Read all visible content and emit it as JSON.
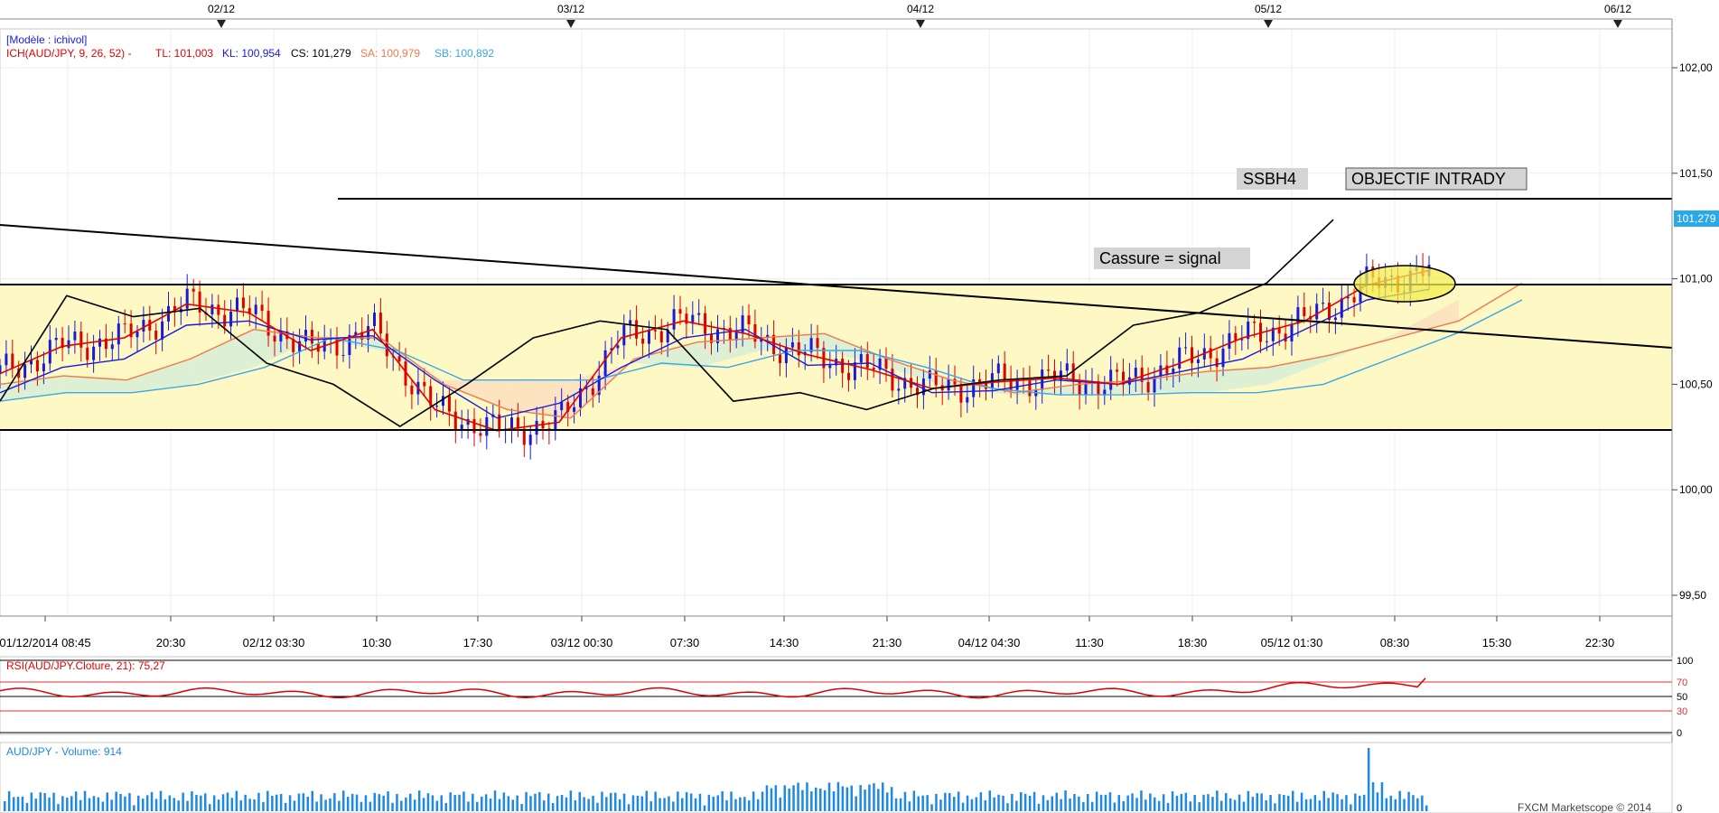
{
  "header": {
    "model_label": "[Modèle : ichivol]",
    "ich_label": "ICH(AUD/JPY, 9, 26, 52) -",
    "tl_label": "TL: 101,003",
    "kl_label": "KL: 100,954",
    "cs_label": "CS: 101,279",
    "sa_label": "SA: 100,979",
    "sb_label": "SB: 100,892"
  },
  "top_dates": [
    "02/12",
    "03/12",
    "04/12",
    "05/12",
    "06/12"
  ],
  "time_axis": [
    "01/12/2014 08:45",
    "20:30",
    "02/12 03:30",
    "10:30",
    "17:30",
    "03/12 00:30",
    "07:30",
    "14:30",
    "21:30",
    "04/12 04:30",
    "11:30",
    "18:30",
    "05/12 01:30",
    "08:30",
    "15:30",
    "22:30"
  ],
  "price_axis": [
    "102,00",
    "101,50",
    "101,00",
    "100,50",
    "100,00",
    "99,50"
  ],
  "last_price": "101,279",
  "annotations": {
    "ssbh4": "SSBH4",
    "objectif": "OBJECTIF INTRADY",
    "cassure": "Cassure = signal"
  },
  "rsi": {
    "label": "RSI(AUD/JPY.Cloture, 21): 75,27",
    "levels": [
      "100",
      "70",
      "50",
      "30",
      "0"
    ]
  },
  "volume": {
    "label": "AUD/JPY - Volume: 914",
    "axis_label": "0"
  },
  "footer": "FXCM Marketscope © 2014",
  "colors": {
    "tenkan": "#e00000",
    "kijun": "#1a1adc",
    "chikou": "#000000",
    "senkou_a": "#f07848",
    "senkou_b": "#38a8e8",
    "range_fill": "#fdf8c4",
    "kumo_bull": "#d7eed7",
    "kumo_bear": "#fbe0c0",
    "volume": "#1e88e5",
    "ellipse": "#f3ee4a"
  },
  "chart_data": {
    "type": "line",
    "title": "AUD/JPY",
    "ylim": [
      99.4,
      102.2
    ],
    "levels": {
      "resistance_objective": 101.36,
      "range_high": 100.96,
      "range_low": 100.27
    },
    "series": [
      {
        "name": "TL",
        "values": [
          100.55,
          100.68,
          100.72,
          100.88,
          100.84,
          100.66,
          100.76,
          100.38,
          100.28,
          100.32,
          100.72,
          100.8,
          100.74,
          100.64,
          100.57,
          100.48,
          100.51,
          100.53,
          100.5,
          100.6,
          100.72,
          100.8,
          100.97,
          101.04
        ]
      },
      {
        "name": "KL",
        "values": [
          100.46,
          100.58,
          100.62,
          100.78,
          100.8,
          100.71,
          100.73,
          100.52,
          100.34,
          100.41,
          100.58,
          100.72,
          100.76,
          100.59,
          100.6,
          100.46,
          100.47,
          100.52,
          100.5,
          100.56,
          100.62,
          100.76,
          100.9,
          100.95
        ]
      },
      {
        "name": "CS",
        "values": [
          100.42,
          100.92,
          100.82,
          100.86,
          100.6,
          100.5,
          100.3,
          100.5,
          100.72,
          100.8,
          100.76,
          100.42,
          100.46,
          100.38,
          100.48,
          100.52,
          100.54,
          100.78,
          100.84,
          100.98,
          101.28
        ]
      },
      {
        "name": "SA",
        "values": [
          100.5,
          100.54,
          100.52,
          100.62,
          100.76,
          100.72,
          100.72,
          100.5,
          100.38,
          100.34,
          100.62,
          100.7,
          100.72,
          100.74,
          100.62,
          100.52,
          100.46,
          100.5,
          100.52,
          100.56,
          100.58,
          100.64,
          100.72,
          100.8,
          100.98
        ]
      },
      {
        "name": "SB",
        "values": [
          100.42,
          100.46,
          100.46,
          100.5,
          100.58,
          100.72,
          100.66,
          100.52,
          100.52,
          100.52,
          100.6,
          100.58,
          100.66,
          100.66,
          100.58,
          100.48,
          100.45,
          100.45,
          100.46,
          100.46,
          100.5,
          100.62,
          100.74,
          100.9
        ]
      }
    ],
    "rsi_last": 75.27,
    "volume_last": 914
  }
}
